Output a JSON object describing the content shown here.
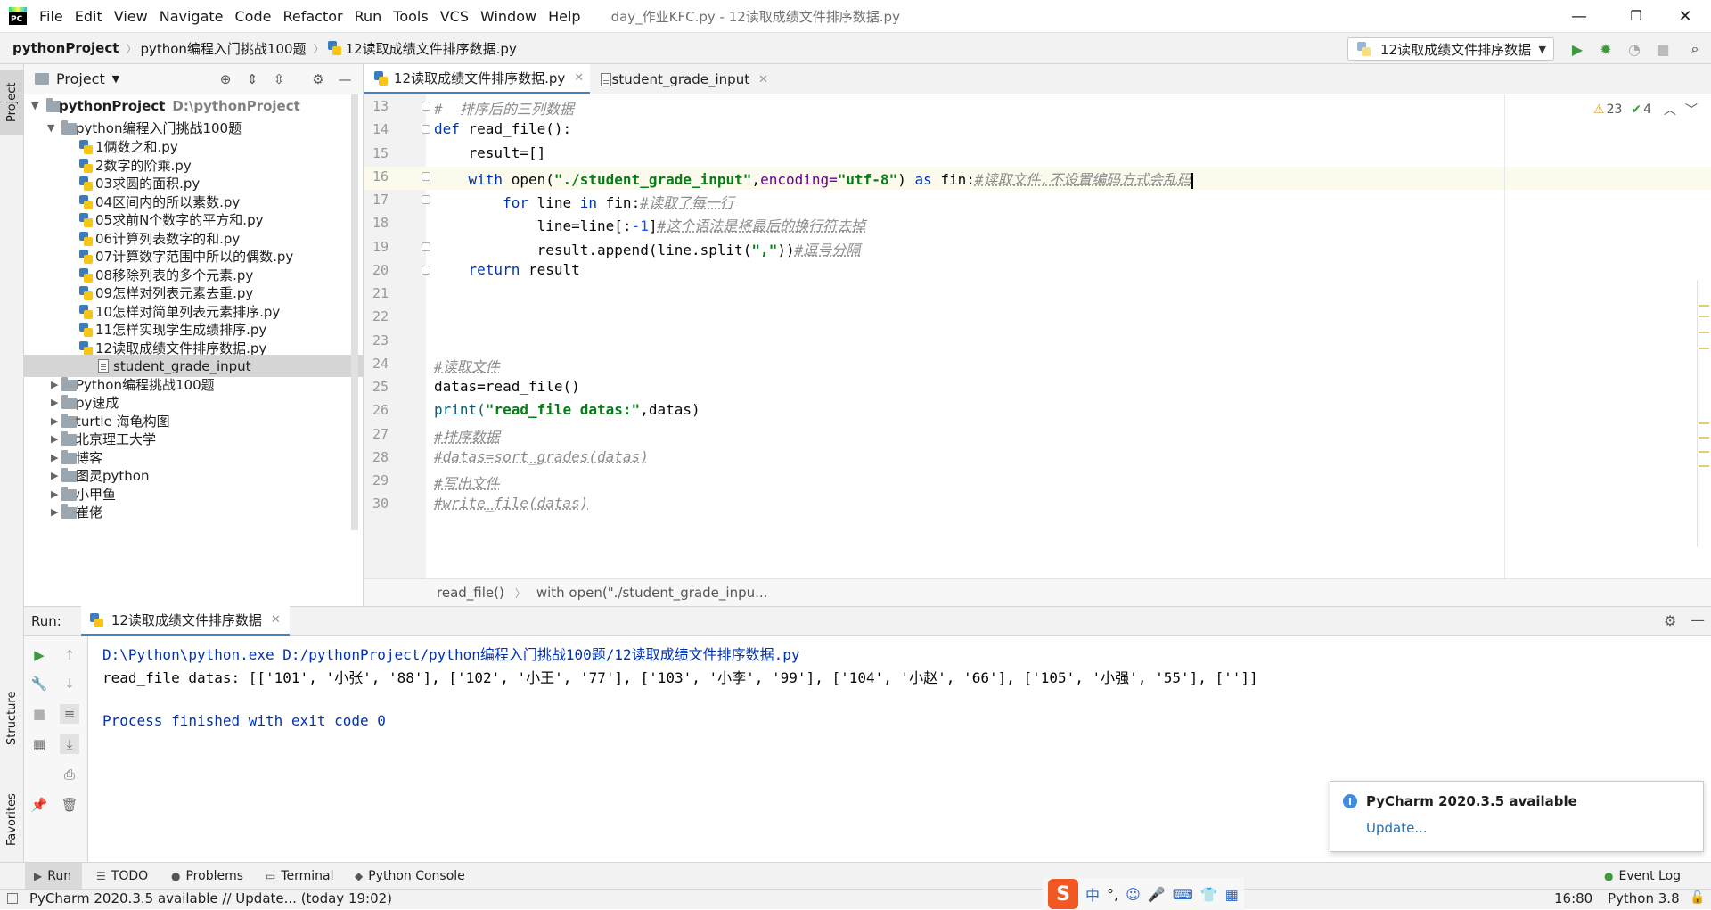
{
  "menu": {
    "items": [
      "File",
      "Edit",
      "View",
      "Navigate",
      "Code",
      "Refactor",
      "Run",
      "Tools",
      "VCS",
      "Window",
      "Help"
    ],
    "window_title": "day_作业KFC.py - 12读取成绩文件排序数据.py"
  },
  "window_controls": {
    "minimize": "—",
    "restore": "❐",
    "close": "✕"
  },
  "nav": {
    "crumbs": [
      "pythonProject",
      "python编程入门挑战100题",
      "12读取成绩文件排序数据.py"
    ],
    "run_config": "12读取成绩文件排序数据"
  },
  "left_strip": {
    "project": "Project",
    "structure": "Structure",
    "favorites": "Favorites"
  },
  "project_panel": {
    "title": "Project",
    "root": {
      "name": "pythonProject",
      "path": "D:\\pythonProject"
    },
    "folder_open": "python编程入门挑战100题",
    "files": [
      "1俩数之和.py",
      "2数字的阶乘.py",
      "03求圆的面积.py",
      "04区间内的所以素数.py",
      "05求前N个数字的平方和.py",
      "06计算列表数字的和.py",
      "07计算数字范围中所以的偶数.py",
      "08移除列表的多个元素.py",
      "09怎样对列表元素去重.py",
      "10怎样对简单列表元素排序.py",
      "11怎样实现学生成绩排序.py",
      "12读取成绩文件排序数据.py",
      "student_grade_input"
    ],
    "selected_file": "student_grade_input",
    "folders": [
      "Python编程挑战100题",
      "py速成",
      "turtle 海龟构图",
      "北京理工大学",
      "博客",
      "图灵python",
      "小甲鱼",
      "崔佬"
    ]
  },
  "editor_tabs": [
    {
      "label": "12读取成绩文件排序数据.py",
      "active": true
    },
    {
      "label": "student_grade_input",
      "active": false
    }
  ],
  "editor": {
    "line_numbers": [
      "13",
      "14",
      "15",
      "16",
      "17",
      "18",
      "19",
      "20",
      "21",
      "22",
      "23",
      "24",
      "25",
      "26",
      "27",
      "28",
      "29",
      "30"
    ],
    "lines": {
      "l13_cm": "#  排序后的三列数据",
      "l14_def": "def",
      "l14_name": " read_file():",
      "l15": "    result=[]",
      "l16_with": "    with",
      "l16_open": " open(",
      "l16_path": "\"./student_grade_input\"",
      "l16_comma": ",",
      "l16_enc": "encoding=",
      "l16_utf": "\"utf-8\"",
      "l16_close": ") ",
      "l16_as": "as",
      "l16_fin": " fin:",
      "l16_cm": "#读取文件,不设置编码方式会乱码",
      "l17_for": "        for",
      "l17_line": " line ",
      "l17_in": "in",
      "l17_fin": " fin:",
      "l17_cm": "#读取了每一行",
      "l18_a": "            line=line[:",
      "l18_num": "-1",
      "l18_b": "]",
      "l18_cm": "#这个语法是将最后的换行符去掉",
      "l19_a": "            result.append(line.split(",
      "l19_str": "\",\"",
      "l19_b": "))",
      "l19_cm": "#逗号分隔",
      "l20_ret": "    return",
      "l20_res": " result",
      "l24_cm": "#读取文件",
      "l25": "datas=read_file()",
      "l26_print": "print(",
      "l26_str": "\"read_file datas:\"",
      "l26_rest": ",datas)",
      "l27_cm": "#排序数据",
      "l28_cm": "#datas=sort_grades(datas)",
      "l29_cm": "#写出文件",
      "l30_cm": "#write_file(datas)"
    },
    "inspections": {
      "warnings": "23",
      "weak_warnings": "4"
    }
  },
  "editor_breadcrumb": [
    "read_file()",
    "with open(\"./student_grade_inpu..."
  ],
  "run": {
    "label": "Run:",
    "tab": "12读取成绩文件排序数据",
    "console": [
      "D:\\Python\\python.exe D:/pythonProject/python编程入门挑战100题/12读取成绩文件排序数据.py",
      "read_file datas: [['101', '小张', '88'], ['102', '小王', '77'], ['103', '小李', '99'], ['104', '小赵', '66'], ['105', '小强', '55'], ['']]",
      "Process finished with exit code 0"
    ]
  },
  "notification": {
    "title": "PyCharm 2020.3.5 available",
    "link": "Update..."
  },
  "bottom_tools": [
    "Run",
    "TODO",
    "Problems",
    "Terminal",
    "Python Console",
    "Event Log"
  ],
  "status": {
    "text": "PyCharm 2020.3.5 available // Update... (today 19:02)",
    "position": "16:80",
    "interpreter": "Python 3.8",
    "ime": {
      "logo": "S",
      "lang": "中",
      "punct": "°,"
    }
  },
  "colors": {
    "accent": "#4083c9",
    "run_green": "#3c9a3c",
    "keyword": "#0033b3",
    "string": "#067d17"
  }
}
